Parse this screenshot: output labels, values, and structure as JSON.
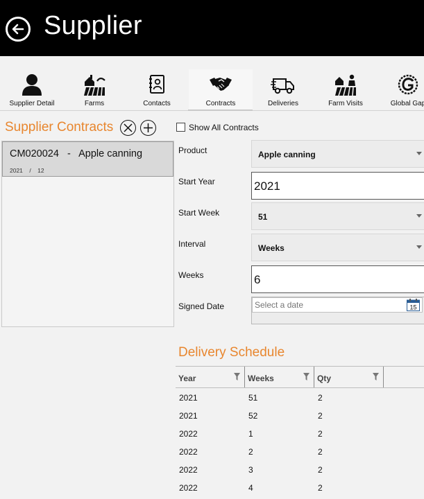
{
  "header": {
    "title": "Supplier"
  },
  "tabs": [
    {
      "label": "Supplier Detail",
      "icon": "person-icon"
    },
    {
      "label": "Farms",
      "icon": "farm-icon"
    },
    {
      "label": "Contacts",
      "icon": "contact-book-icon"
    },
    {
      "label": "Contracts",
      "icon": "handshake-icon",
      "active": true
    },
    {
      "label": "Deliveries",
      "icon": "delivery-truck-icon"
    },
    {
      "label": "Farm Visits",
      "icon": "farm-visit-icon"
    },
    {
      "label": "Global Gap",
      "icon": "global-gap-logo-icon"
    }
  ],
  "contracts": {
    "title": "Supplier Contracts",
    "items": [
      {
        "main": "CM020024   -   Apple canning",
        "sub": "2021    /    12"
      }
    ]
  },
  "show_all": {
    "label": "Show All Contracts",
    "checked": false
  },
  "form": {
    "product": {
      "label": "Product",
      "value": "Apple canning"
    },
    "start_year": {
      "label": "Start Year",
      "value": "2021"
    },
    "start_week": {
      "label": "Start Week",
      "value": "51"
    },
    "interval": {
      "label": "Interval",
      "value": "Weeks"
    },
    "weeks": {
      "label": "Weeks",
      "value": "6"
    },
    "signed_date": {
      "label": "Signed Date",
      "placeholder": "Select a date",
      "calendar_day": "15"
    }
  },
  "schedule": {
    "title": "Delivery Schedule",
    "columns": [
      "Year",
      "Weeks",
      "Qty"
    ],
    "rows": [
      [
        "2021",
        "51",
        "2"
      ],
      [
        "2021",
        "52",
        "2"
      ],
      [
        "2022",
        "1",
        "2"
      ],
      [
        "2022",
        "2",
        "2"
      ],
      [
        "2022",
        "3",
        "2"
      ],
      [
        "2022",
        "4",
        "2"
      ]
    ]
  },
  "colors": {
    "accent": "#e8862e",
    "header_bg": "#000000"
  }
}
